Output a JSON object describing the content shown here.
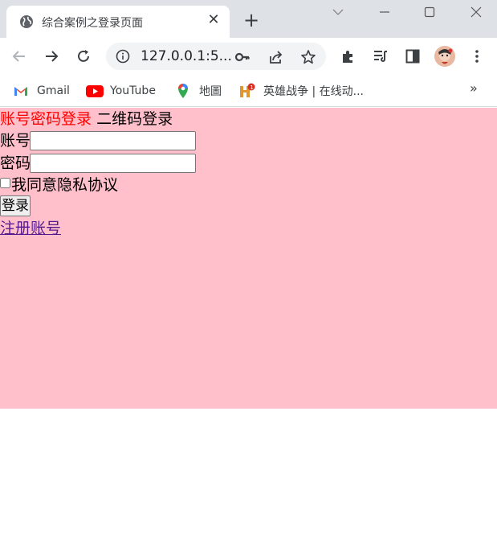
{
  "browser": {
    "tab_title": "综合案例之登录页面",
    "url": "127.0.0.1:5...",
    "bookmarks": [
      {
        "label": "Gmail",
        "icon": "gmail-icon"
      },
      {
        "label": "YouTube",
        "icon": "youtube-icon"
      },
      {
        "label": "地圖",
        "icon": "maps-icon"
      },
      {
        "label": "英雄战争 | 在线动...",
        "icon": "hero-war-icon"
      }
    ],
    "bookmarks_more": "»"
  },
  "login": {
    "tab_password": "账号密码登录",
    "tab_qrcode": "二维码登录",
    "account_label": "账号",
    "password_label": "密码",
    "agree_label": "我同意隐私协议",
    "login_button": "登录",
    "register_link": "注册账号"
  },
  "colors": {
    "page_bg": "#ffc0cb",
    "active_tab": "#ff0000",
    "link_visited": "#551a8b"
  }
}
